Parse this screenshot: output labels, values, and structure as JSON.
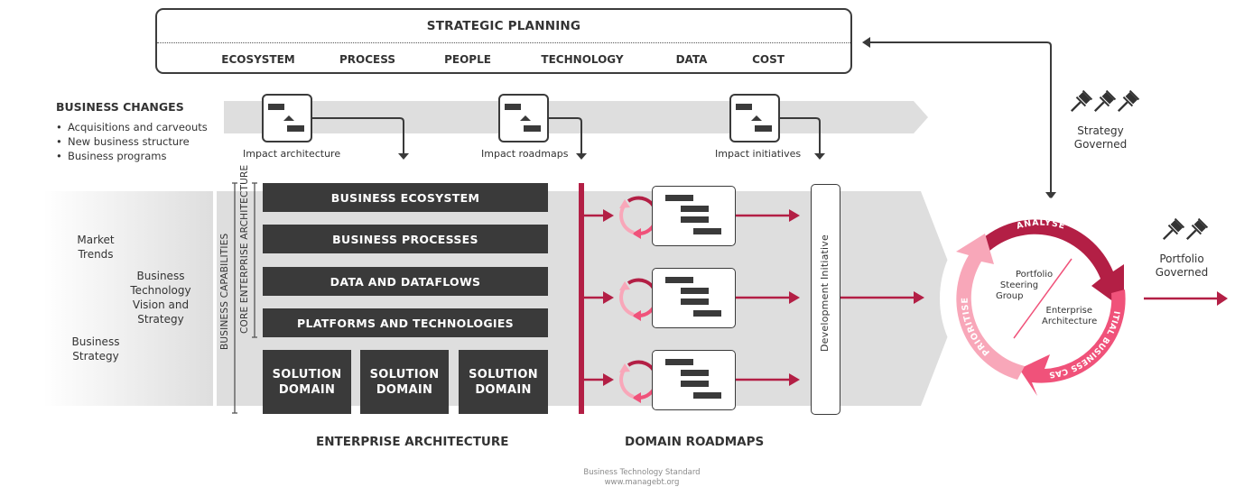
{
  "strategic_planning": {
    "title": "STRATEGIC PLANNING",
    "items": [
      "ECOSYSTEM",
      "PROCESS",
      "PEOPLE",
      "TECHNOLOGY",
      "DATA",
      "COST"
    ]
  },
  "business_changes": {
    "title": "BUSINESS CHANGES",
    "items": [
      "Acquisitions and carveouts",
      "New business structure",
      "Business programs"
    ]
  },
  "impacts": [
    {
      "label": "Impact architecture"
    },
    {
      "label": "Impact roadmaps"
    },
    {
      "label": "Impact initiatives"
    }
  ],
  "left_inputs": {
    "market_trends": [
      "Market",
      "Trends"
    ],
    "bt_vision": [
      "Business",
      "Technology",
      "Vision and",
      "Strategy"
    ],
    "business_strategy": [
      "Business",
      "Strategy"
    ]
  },
  "vertical_labels": {
    "business_capabilities": "BUSINESS CAPABILITIES",
    "core_ea": "CORE ENTERPRISE ARCHITECTURE",
    "development_initiative": "Development Initiative"
  },
  "ea_layers": [
    "BUSINESS ECOSYSTEM",
    "BUSINESS PROCESSES",
    "DATA AND DATAFLOWS",
    "PLATFORMS AND TECHNOLOGIES"
  ],
  "solution_domains": [
    {
      "line1": "SOLUTION",
      "line2": "DOMAIN"
    },
    {
      "line1": "SOLUTION",
      "line2": "DOMAIN"
    },
    {
      "line1": "SOLUTION",
      "line2": "DOMAIN"
    }
  ],
  "section_titles": {
    "enterprise_architecture": "ENTERPRISE ARCHITECTURE",
    "domain_roadmaps": "DOMAIN ROADMAPS"
  },
  "governance": {
    "strategy": {
      "line1": "Strategy",
      "line2": "Governed",
      "gavel_count": 3
    },
    "portfolio": {
      "line1": "Portfolio",
      "line2": "Governed",
      "gavel_count": 2
    }
  },
  "cycle": {
    "stages": [
      "ANALYSE",
      "INITIAL BUSINESS CASE",
      "PRIORITISE"
    ],
    "center_top": [
      "Portfolio",
      "Steering",
      "Group"
    ],
    "center_bottom": [
      "Enterprise",
      "Architecture"
    ]
  },
  "footer": {
    "line1": "Business Technology Standard",
    "line2": "www.managebt.org"
  },
  "colors": {
    "dark": "#3a3a3a",
    "crimson": "#b31f45",
    "pink": "#f0527a",
    "light_pink": "#f8a7b9",
    "band_grey": "#dcdcdc"
  }
}
